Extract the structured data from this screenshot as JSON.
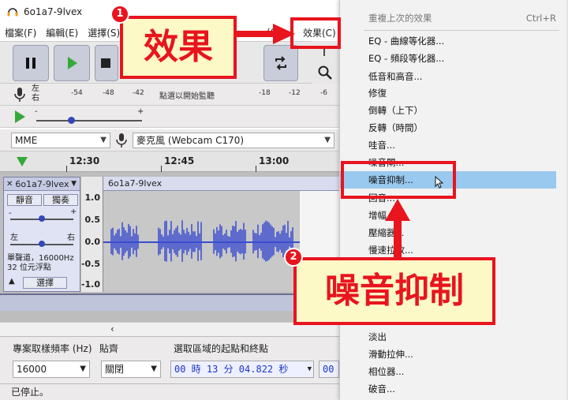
{
  "window": {
    "title": "6o1a7-9lvex"
  },
  "menubar": {
    "file": "檔案(F)",
    "edit": "編輯(E)",
    "select": "選擇(S)",
    "generate": "(G)",
    "effect": "效果(C)"
  },
  "meters": {
    "rec_channels": "左\n右",
    "rec_left": "左",
    "rec_right": "右",
    "scale": [
      "-54",
      "-48",
      "-42",
      "點選以開始監聽",
      "-18",
      "-12",
      "-6"
    ]
  },
  "devices": {
    "host": "MME",
    "input": "麥克風 (Webcam C170)"
  },
  "timeline": {
    "ticks": [
      "12:30",
      "12:45",
      "13:00"
    ]
  },
  "track": {
    "name": "6o1a7-9lvex",
    "mute": "靜音",
    "solo": "獨奏",
    "pan_left": "左",
    "pan_right": "右",
    "info_line1": "單聲道，16000Hz",
    "info_line2": "32 位元浮點",
    "select": "選擇",
    "clip_name": "6o1a7-9lvex",
    "ruler": [
      "1.0",
      "0.5",
      "0.0",
      "-0.5",
      "-1.0"
    ],
    "gain_minus": "-",
    "gain_plus": "+"
  },
  "selection": {
    "rate_label": "專案取樣頻率 (Hz)",
    "snap_label": "貼齊",
    "range_label": "選取區域的起點和終點",
    "rate_value": "16000",
    "snap_value": "關閉",
    "start_time": "00 時 13 分 04.822 秒",
    "end_time_partial": "00"
  },
  "status": {
    "text": "已停止。"
  },
  "effect_menu": {
    "items": [
      {
        "label": "重複上次的效果",
        "shortcut": "Ctrl+R",
        "disabled": true
      },
      {
        "label": "EQ - 曲線等化器..."
      },
      {
        "label": "EQ - 頻段等化器..."
      },
      {
        "label": "低音和高音..."
      },
      {
        "label": "修復"
      },
      {
        "label": "倒轉（上下）"
      },
      {
        "label": "反轉（時間）"
      },
      {
        "label": "哇音..."
      },
      {
        "label": "噪音閘..."
      },
      {
        "label": "噪音抑制...",
        "highlight": true
      },
      {
        "label": "回音..."
      },
      {
        "label": "增幅..."
      },
      {
        "label": "壓縮器..."
      },
      {
        "label": "慢速拉放..."
      },
      {
        "label": "淡出"
      },
      {
        "label": "滑動拉伸..."
      },
      {
        "label": "相位器..."
      },
      {
        "label": "破音..."
      }
    ]
  },
  "annotations": {
    "callout1": "效果",
    "callout2": "噪音抑制",
    "badge1": "1",
    "badge2": "2",
    "color": "#e8141e"
  },
  "colors": {
    "wave": "#3a4ccf",
    "highlight": "#99c9ef",
    "time_text": "#1b36c8"
  }
}
